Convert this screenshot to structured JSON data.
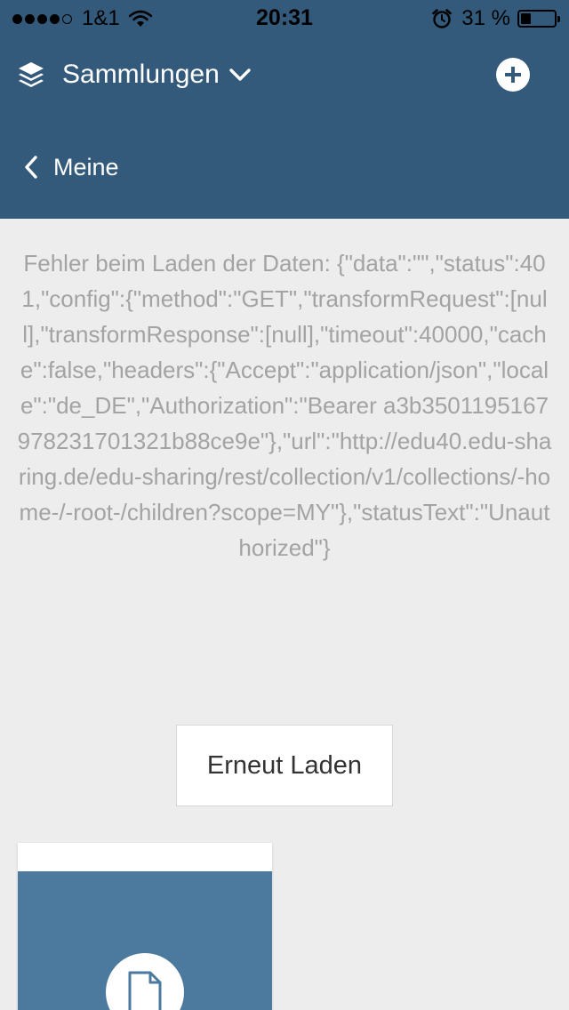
{
  "status_bar": {
    "carrier": "1&1",
    "time": "20:31",
    "battery_percent": "31 %",
    "battery_level": 0.31,
    "signal_bars_filled": 4,
    "signal_bars_total": 5
  },
  "header": {
    "title": "Sammlungen",
    "back_label": "Meine",
    "background_color": "#335a7a"
  },
  "error": {
    "message": "Fehler beim Laden der Daten: {\"data\":\"\",\"status\":401,\"config\":{\"method\":\"GET\",\"transformRequest\":[null],\"transformResponse\":[null],\"timeout\":40000,\"cache\":false,\"headers\":{\"Accept\":\"application/json\",\"locale\":\"de_DE\",\"Authorization\":\"Bearer a3b350119516797823170132​1b88ce9e\"},\"url\":\"http://edu40.edu-sharing.de/edu-sharing/rest/collection/v1/collections/-home-/-root-/children?scope=MY\"},\"statusText\":\"Unauthorized\"}",
    "reload_label": "Erneut Laden"
  },
  "icons": {
    "collections": "layers-icon",
    "dropdown": "chevron-down-icon",
    "add": "plus-circle-icon",
    "back": "chevron-left-icon",
    "card": "file-icon"
  }
}
